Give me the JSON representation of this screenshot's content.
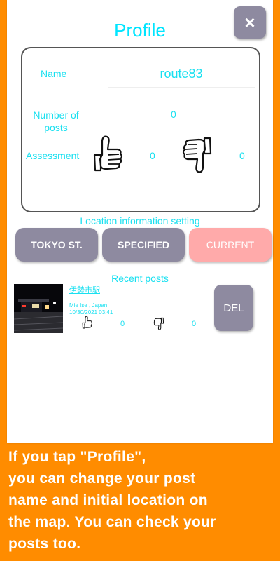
{
  "profile": {
    "title": "Profile",
    "close_label": "×",
    "name_label": "Name",
    "name_value": "route83",
    "posts_label": "Number of posts",
    "posts_value": "0",
    "assessment_label": "Assessment",
    "likes": "0",
    "dislikes": "0"
  },
  "location": {
    "label": "Location information setting",
    "buttons": [
      {
        "label": "TOKYO ST."
      },
      {
        "label": "SPECIFIED"
      },
      {
        "label": "CURRENT"
      }
    ]
  },
  "recent": {
    "label": "Recent posts",
    "posts": [
      {
        "title": "伊勢市駅",
        "location": "Mie Ise , Japan",
        "date": "10/30/2021 03:41",
        "likes": "0",
        "dislikes": "0",
        "delete_label": "DEL"
      }
    ]
  },
  "caption": {
    "lines": [
      "If you tap \"Profile\",",
      "you can change your post",
      "name and initial location on",
      "the map. You can check your",
      "posts too."
    ]
  },
  "colors": {
    "background": "#ff8c00",
    "accent": "#19e0f0",
    "button": "#8e8aa0",
    "current_button": "#ffaaaa"
  },
  "icons": [
    "close-icon",
    "thumbs-up-icon",
    "thumbs-down-icon"
  ]
}
